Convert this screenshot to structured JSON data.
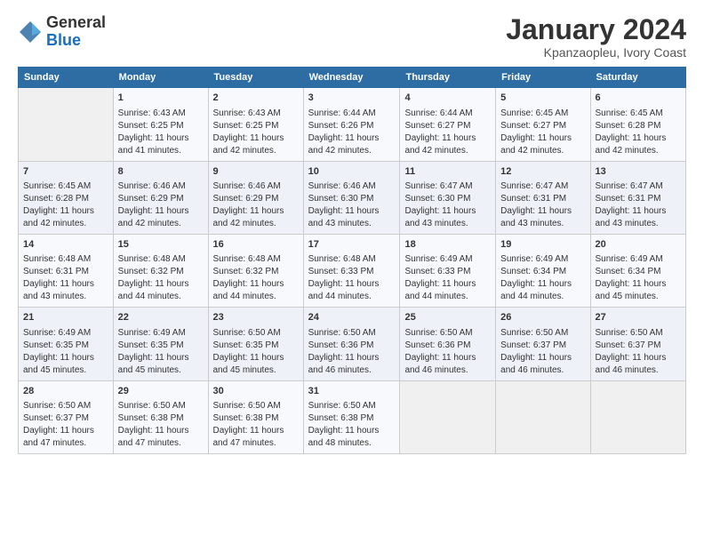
{
  "header": {
    "logo_line1": "General",
    "logo_line2": "Blue",
    "title": "January 2024",
    "subtitle": "Kpanzaopleu, Ivory Coast"
  },
  "columns": [
    "Sunday",
    "Monday",
    "Tuesday",
    "Wednesday",
    "Thursday",
    "Friday",
    "Saturday"
  ],
  "weeks": [
    [
      {
        "day": "",
        "text": ""
      },
      {
        "day": "1",
        "text": "Sunrise: 6:43 AM\nSunset: 6:25 PM\nDaylight: 11 hours\nand 41 minutes."
      },
      {
        "day": "2",
        "text": "Sunrise: 6:43 AM\nSunset: 6:25 PM\nDaylight: 11 hours\nand 42 minutes."
      },
      {
        "day": "3",
        "text": "Sunrise: 6:44 AM\nSunset: 6:26 PM\nDaylight: 11 hours\nand 42 minutes."
      },
      {
        "day": "4",
        "text": "Sunrise: 6:44 AM\nSunset: 6:27 PM\nDaylight: 11 hours\nand 42 minutes."
      },
      {
        "day": "5",
        "text": "Sunrise: 6:45 AM\nSunset: 6:27 PM\nDaylight: 11 hours\nand 42 minutes."
      },
      {
        "day": "6",
        "text": "Sunrise: 6:45 AM\nSunset: 6:28 PM\nDaylight: 11 hours\nand 42 minutes."
      }
    ],
    [
      {
        "day": "7",
        "text": "Sunrise: 6:45 AM\nSunset: 6:28 PM\nDaylight: 11 hours\nand 42 minutes."
      },
      {
        "day": "8",
        "text": "Sunrise: 6:46 AM\nSunset: 6:29 PM\nDaylight: 11 hours\nand 42 minutes."
      },
      {
        "day": "9",
        "text": "Sunrise: 6:46 AM\nSunset: 6:29 PM\nDaylight: 11 hours\nand 42 minutes."
      },
      {
        "day": "10",
        "text": "Sunrise: 6:46 AM\nSunset: 6:30 PM\nDaylight: 11 hours\nand 43 minutes."
      },
      {
        "day": "11",
        "text": "Sunrise: 6:47 AM\nSunset: 6:30 PM\nDaylight: 11 hours\nand 43 minutes."
      },
      {
        "day": "12",
        "text": "Sunrise: 6:47 AM\nSunset: 6:31 PM\nDaylight: 11 hours\nand 43 minutes."
      },
      {
        "day": "13",
        "text": "Sunrise: 6:47 AM\nSunset: 6:31 PM\nDaylight: 11 hours\nand 43 minutes."
      }
    ],
    [
      {
        "day": "14",
        "text": "Sunrise: 6:48 AM\nSunset: 6:31 PM\nDaylight: 11 hours\nand 43 minutes."
      },
      {
        "day": "15",
        "text": "Sunrise: 6:48 AM\nSunset: 6:32 PM\nDaylight: 11 hours\nand 44 minutes."
      },
      {
        "day": "16",
        "text": "Sunrise: 6:48 AM\nSunset: 6:32 PM\nDaylight: 11 hours\nand 44 minutes."
      },
      {
        "day": "17",
        "text": "Sunrise: 6:48 AM\nSunset: 6:33 PM\nDaylight: 11 hours\nand 44 minutes."
      },
      {
        "day": "18",
        "text": "Sunrise: 6:49 AM\nSunset: 6:33 PM\nDaylight: 11 hours\nand 44 minutes."
      },
      {
        "day": "19",
        "text": "Sunrise: 6:49 AM\nSunset: 6:34 PM\nDaylight: 11 hours\nand 44 minutes."
      },
      {
        "day": "20",
        "text": "Sunrise: 6:49 AM\nSunset: 6:34 PM\nDaylight: 11 hours\nand 45 minutes."
      }
    ],
    [
      {
        "day": "21",
        "text": "Sunrise: 6:49 AM\nSunset: 6:35 PM\nDaylight: 11 hours\nand 45 minutes."
      },
      {
        "day": "22",
        "text": "Sunrise: 6:49 AM\nSunset: 6:35 PM\nDaylight: 11 hours\nand 45 minutes."
      },
      {
        "day": "23",
        "text": "Sunrise: 6:50 AM\nSunset: 6:35 PM\nDaylight: 11 hours\nand 45 minutes."
      },
      {
        "day": "24",
        "text": "Sunrise: 6:50 AM\nSunset: 6:36 PM\nDaylight: 11 hours\nand 46 minutes."
      },
      {
        "day": "25",
        "text": "Sunrise: 6:50 AM\nSunset: 6:36 PM\nDaylight: 11 hours\nand 46 minutes."
      },
      {
        "day": "26",
        "text": "Sunrise: 6:50 AM\nSunset: 6:37 PM\nDaylight: 11 hours\nand 46 minutes."
      },
      {
        "day": "27",
        "text": "Sunrise: 6:50 AM\nSunset: 6:37 PM\nDaylight: 11 hours\nand 46 minutes."
      }
    ],
    [
      {
        "day": "28",
        "text": "Sunrise: 6:50 AM\nSunset: 6:37 PM\nDaylight: 11 hours\nand 47 minutes."
      },
      {
        "day": "29",
        "text": "Sunrise: 6:50 AM\nSunset: 6:38 PM\nDaylight: 11 hours\nand 47 minutes."
      },
      {
        "day": "30",
        "text": "Sunrise: 6:50 AM\nSunset: 6:38 PM\nDaylight: 11 hours\nand 47 minutes."
      },
      {
        "day": "31",
        "text": "Sunrise: 6:50 AM\nSunset: 6:38 PM\nDaylight: 11 hours\nand 48 minutes."
      },
      {
        "day": "",
        "text": ""
      },
      {
        "day": "",
        "text": ""
      },
      {
        "day": "",
        "text": ""
      }
    ]
  ]
}
